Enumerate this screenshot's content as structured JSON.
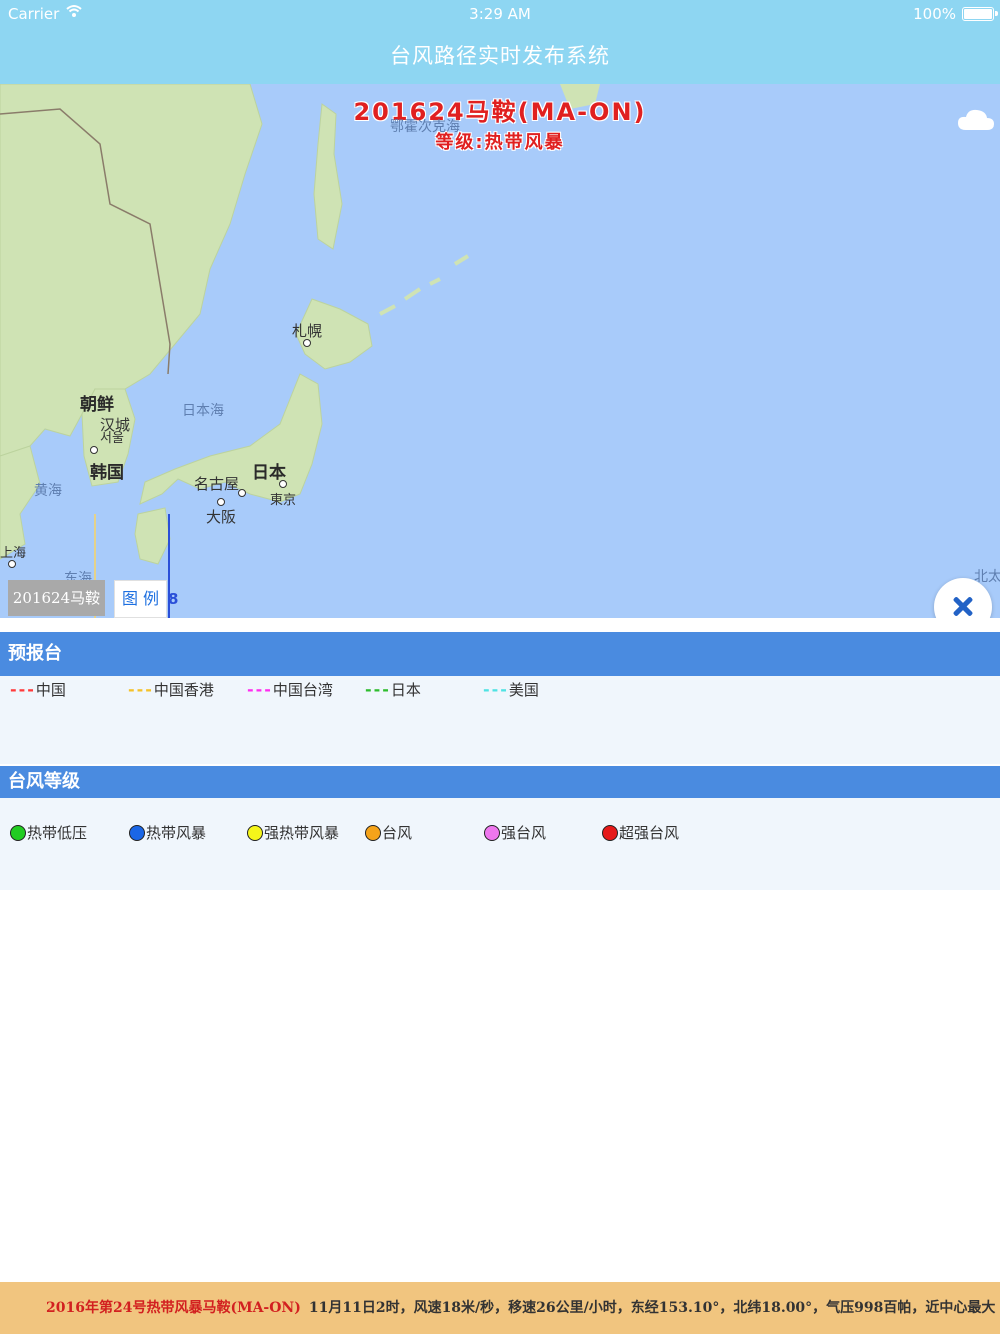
{
  "status_bar": {
    "carrier": "Carrier",
    "time": "3:29 AM",
    "battery": "100%",
    "battery_level": 1.0
  },
  "app": {
    "title": "台风路径实时发布系统"
  },
  "map": {
    "storm_name": "201624马鞍(MA-ON)",
    "storm_level": "等级:热带风暴",
    "labels": {
      "okhotsk": "鄂霍次克海",
      "sapporo": "札幌",
      "north_korea": "朝鲜",
      "hancheng": "汉城",
      "seoul_kr": "서울",
      "sea_of_japan": "日本海",
      "south_korea": "韩国",
      "japan": "日本",
      "nagoya": "名古屋",
      "tokyo": "東京",
      "osaka": "大阪",
      "yellow_sea": "黄海",
      "shanghai": "上海",
      "east_sea": "东海",
      "north_pacific": "北太"
    },
    "track_marker": "8",
    "storm_tab": "201624马鞍",
    "legend_tab": "图 例",
    "colors": {
      "sea": "#a8cbfa",
      "land": "#cfe3b4",
      "storm_text": "#e02020"
    }
  },
  "legend": {
    "forecast_title": "预报台",
    "forecast_items": [
      {
        "label": "中国",
        "color": "#ff3b3b"
      },
      {
        "label": "中国香港",
        "color": "#f5c229"
      },
      {
        "label": "中国台湾",
        "color": "#ff2df0"
      },
      {
        "label": "日本",
        "color": "#2ebd2e"
      },
      {
        "label": "美国",
        "color": "#4fe3e3"
      }
    ],
    "level_title": "台风等级",
    "level_items": [
      {
        "label": "热带低压",
        "color": "#22cc22"
      },
      {
        "label": "热带风暴",
        "color": "#1a66e6"
      },
      {
        "label": "强热带风暴",
        "color": "#f5f51a"
      },
      {
        "label": "台风",
        "color": "#f5a31a"
      },
      {
        "label": "强台风",
        "color": "#ee77ee"
      },
      {
        "label": "超强台风",
        "color": "#e61a1a"
      }
    ]
  },
  "ticker": {
    "title": "2016年第24号热带风暴马鞍(MA-ON)",
    "text": "11月11日2时，风速18米/秒，移速26公里/小时，东经153.10°，北纬18.00°，气压998百帕，近中心最大"
  }
}
